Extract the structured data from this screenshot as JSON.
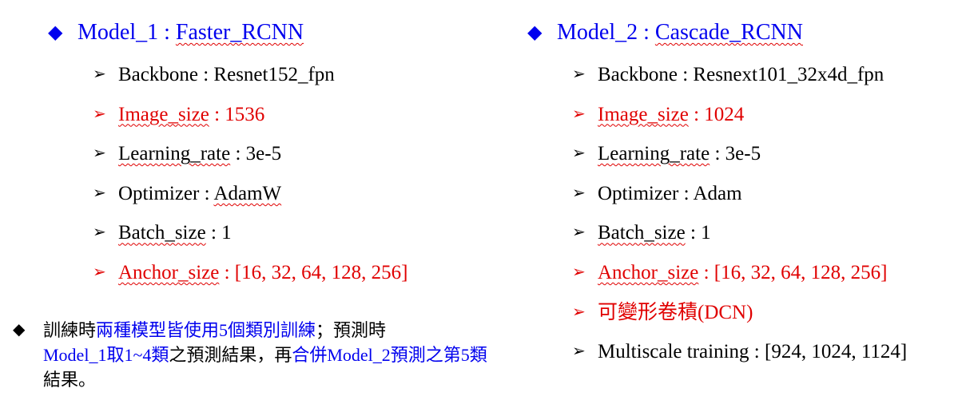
{
  "model1": {
    "heading": [
      "Model_1 : ",
      "Faster_RCNN"
    ],
    "items": [
      {
        "label": "Backbone",
        "sep": " : ",
        "value": "Resnet152_fpn"
      },
      {
        "label": "Image_size",
        "sep": " : ",
        "value": "1536"
      },
      {
        "label": "Learning_rate",
        "sep": " : ",
        "value": "3e-5"
      },
      {
        "label": "Optimizer",
        "sep": " : ",
        "value": "AdamW"
      },
      {
        "label": "Batch_size",
        "sep": " : ",
        "value": "1"
      },
      {
        "label": "Anchor_size",
        "sep": " : ",
        "value": "[16, 32, 64, 128, 256]"
      }
    ]
  },
  "model2": {
    "heading": [
      "Model_2 : ",
      "Cascade_RCNN"
    ],
    "items": [
      {
        "label": "Backbone",
        "sep": " : ",
        "value": "Resnext101_32x4d_fpn"
      },
      {
        "label": "Image_size",
        "sep": " : ",
        "value": "1024"
      },
      {
        "label": "Learning_rate",
        "sep": " : ",
        "value": "3e-5"
      },
      {
        "label": "Optimizer",
        "sep": " : ",
        "value": "Adam"
      },
      {
        "label": "Batch_size",
        "sep": " : ",
        "value": "1"
      },
      {
        "label": "Anchor_size",
        "sep": " : ",
        "value": "[16, 32, 64, 128, 256]"
      },
      {
        "label": "可變形卷積(DCN)",
        "sep": "",
        "value": ""
      },
      {
        "label": "Multiscale training",
        "sep": " : ",
        "value": "[924, 1024, 1124]"
      }
    ]
  },
  "note": {
    "segments": [
      "訓練時",
      "兩種模型皆使用5個類別訓練",
      "；預測時",
      "Model_1取1~4類",
      "之預測結果，再",
      "合併Model_2預測之第5類",
      "結果。"
    ]
  },
  "colors": {
    "blue": "#0000ee",
    "red": "#e00000",
    "black": "#000000"
  },
  "icons": {
    "heading_bullet": "diamond-icon",
    "item_bullet": "arrow-bullet-icon"
  }
}
